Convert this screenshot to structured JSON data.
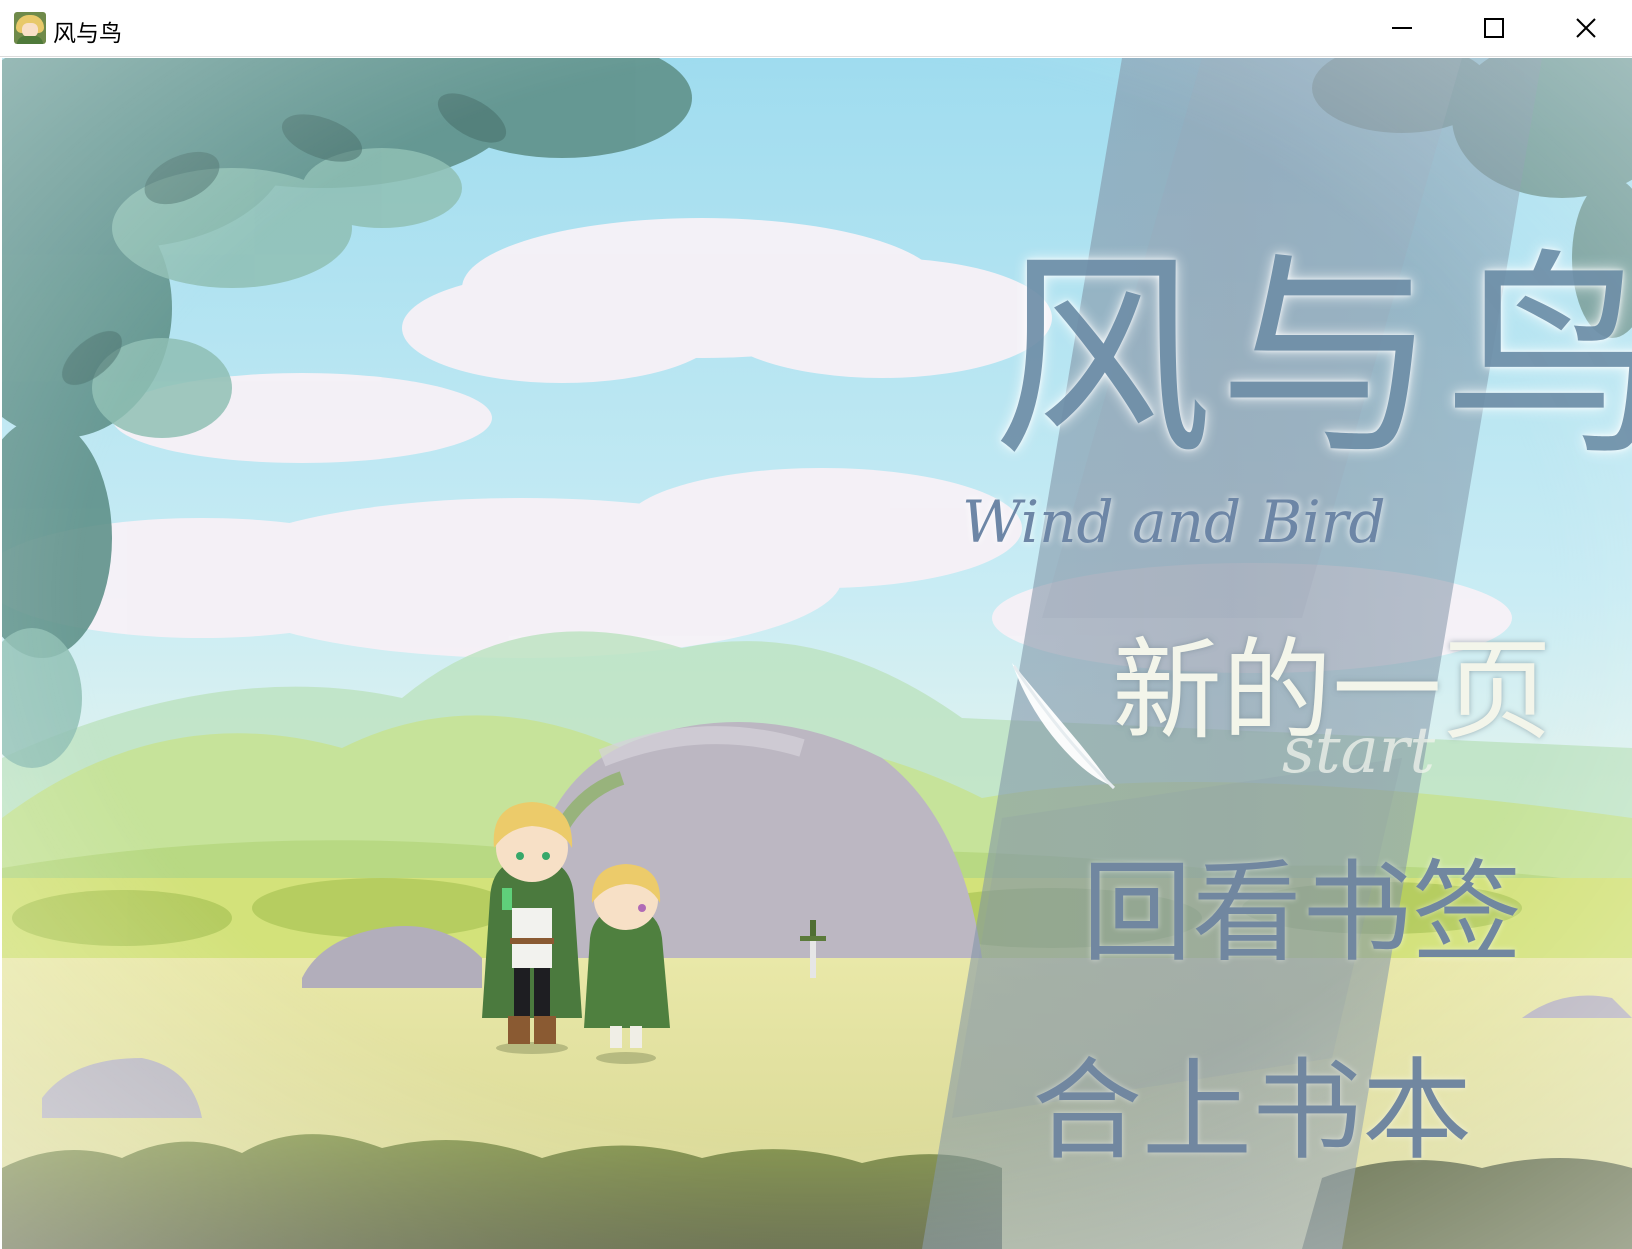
{
  "window": {
    "title": "风与鸟",
    "controls": [
      "minimize",
      "maximize",
      "close"
    ]
  },
  "game": {
    "logo_cn": "风与鸟",
    "logo_en": "Wind and Bird"
  },
  "menu": {
    "items": [
      {
        "label": "新的一页",
        "sub": "start",
        "selected": true
      },
      {
        "label": "回看书签",
        "selected": false
      },
      {
        "label": "合上书本",
        "selected": false
      }
    ]
  },
  "icons": [
    "app-icon",
    "minimize-icon",
    "maximize-icon",
    "close-icon",
    "feather-icon"
  ],
  "colors": {
    "menu_selected": "#f3f5ea",
    "menu_normal": "#7187a0",
    "logo": "#6f8fa8",
    "sky": "#bfe6f3"
  }
}
